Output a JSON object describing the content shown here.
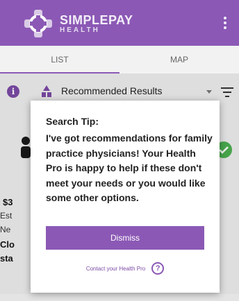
{
  "app": {
    "brand_name": "SIMPLEPAY",
    "brand_sub": "HEALTH",
    "accent_color": "#8b59b5",
    "icons": {
      "logo": "simplepay-logo-icon",
      "menu": "more-vert-icon"
    }
  },
  "tabs": [
    {
      "label": "LIST",
      "selected": true
    },
    {
      "label": "MAP",
      "selected": false
    }
  ],
  "filter": {
    "label": "Recommended Results",
    "icons": {
      "info": "info-icon",
      "recommended": "recommended-icon",
      "caret": "caret-down-icon",
      "filter": "filter-lines-icon"
    }
  },
  "background_card": {
    "price_fragment": "$3",
    "line1_fragment": "Est",
    "line2_fragment": "Ne",
    "bold1_fragment": "Clo",
    "bold2_fragment": "sta",
    "status_color": "#4caf50"
  },
  "dialog": {
    "title": "Search Tip:",
    "body": "I've got recommendations for family practice physicians! Your Health Pro is happy to help if these don't meet your needs or you would like some other options.",
    "dismiss_label": "Dismiss",
    "contact_label": "Contact your Health Pro",
    "help_glyph": "?"
  }
}
